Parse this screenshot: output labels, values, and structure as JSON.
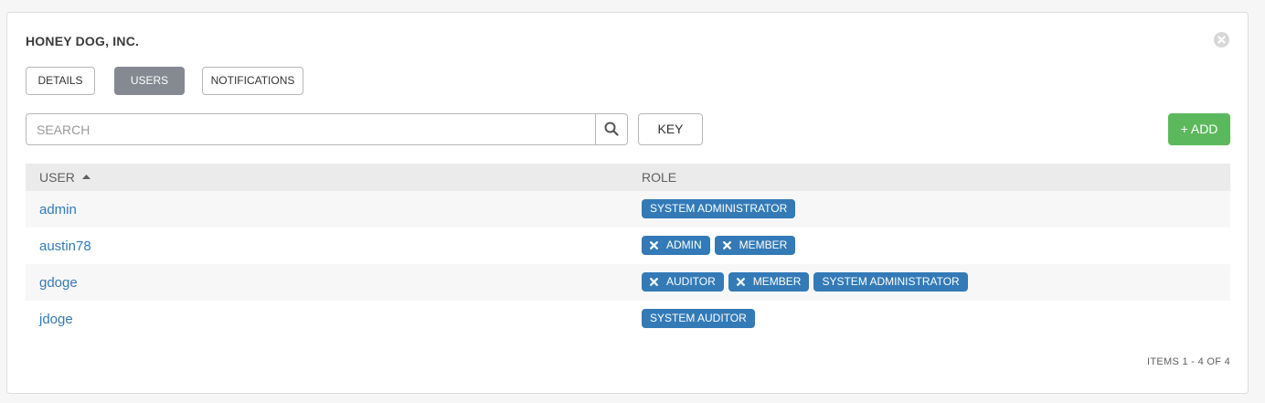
{
  "panel": {
    "title": "HONEY DOG, INC."
  },
  "tabs": [
    {
      "label": "DETAILS",
      "active": false
    },
    {
      "label": "USERS",
      "active": true
    },
    {
      "label": "NOTIFICATIONS",
      "active": false
    }
  ],
  "search": {
    "placeholder": "SEARCH",
    "value": ""
  },
  "toolbar": {
    "key_label": "KEY",
    "add_label": "+ ADD"
  },
  "table": {
    "columns": [
      "USER",
      "ROLE"
    ],
    "sort": {
      "column": "USER",
      "direction": "ascending"
    },
    "rows": [
      {
        "user": "admin",
        "roles": [
          {
            "label": "SYSTEM ADMINISTRATOR",
            "removable": false
          }
        ]
      },
      {
        "user": "austin78",
        "roles": [
          {
            "label": "ADMIN",
            "removable": true
          },
          {
            "label": "MEMBER",
            "removable": true
          }
        ]
      },
      {
        "user": "gdoge",
        "roles": [
          {
            "label": "AUDITOR",
            "removable": true
          },
          {
            "label": "MEMBER",
            "removable": true
          },
          {
            "label": "SYSTEM ADMINISTRATOR",
            "removable": false
          }
        ]
      },
      {
        "user": "jdoge",
        "roles": [
          {
            "label": "SYSTEM AUDITOR",
            "removable": false
          }
        ]
      }
    ]
  },
  "pagination": {
    "text": "ITEMS  1 - 4 OF 4"
  },
  "colors": {
    "accent": "#337ab7",
    "add_button": "#5cb85c",
    "active_tab": "#848992"
  },
  "icons": {
    "close": "close-circle-icon",
    "search": "search-icon",
    "sort": "sort-ascending-icon",
    "remove_role": "remove-role-icon"
  }
}
